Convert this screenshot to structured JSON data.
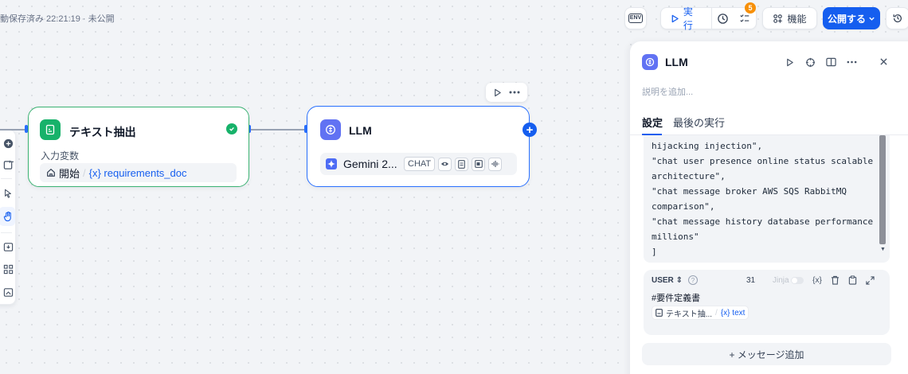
{
  "status": {
    "autosave": "動保存済み 22:21:19 · 未公開"
  },
  "toolbar": {
    "env_label": "ENV",
    "run_label": "実行",
    "checklist_count": "5",
    "features_label": "機能",
    "publish_label": "公開する"
  },
  "nodes": {
    "extract": {
      "title": "テキスト抽出",
      "input_label": "入力変数",
      "source": "開始",
      "separator": "/",
      "variable": "{x} requirements_doc"
    },
    "llm": {
      "title": "LLM",
      "model_name": "Gemini 2...",
      "mode_tag": "CHAT"
    }
  },
  "panel": {
    "title": "LLM",
    "description_placeholder": "説明を追加...",
    "tabs": [
      {
        "label": "設定",
        "active": true
      },
      {
        "label": "最後の実行",
        "active": false
      }
    ],
    "code_lines": [
      "hijacking injection\",",
      "\"chat user presence online status scalable architecture\",",
      "\"chat message broker AWS SQS RabbitMQ comparison\",",
      "\"chat message history database performance millions\"",
      "]"
    ],
    "message": {
      "role": "USER",
      "count": "31",
      "jinja_label": "Jinja",
      "prompt": "#要件定義書",
      "var_source": "テキスト抽...",
      "var_separator": "/",
      "var_name": "{x} text"
    },
    "add_message_label": "+ メッセージ追加"
  },
  "colors": {
    "accent": "#155eef",
    "success": "#17b26a",
    "extract_node_border": "#3bb273",
    "llm_node_border": "#2970ff",
    "badge": "#f79009",
    "llm_icon": "#6172f3"
  }
}
